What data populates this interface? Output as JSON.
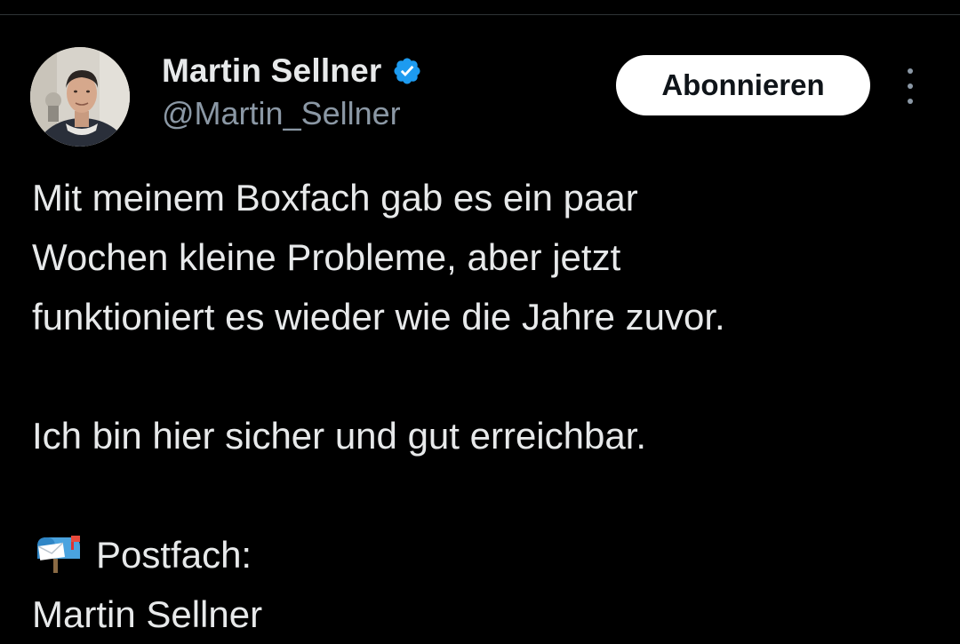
{
  "user": {
    "display_name": "Martin Sellner",
    "handle": "@Martin_Sellner",
    "verified": true,
    "verified_color": "#1d9bf0"
  },
  "actions": {
    "follow_label": "Abonnieren"
  },
  "tweet": {
    "paragraph_1": [
      "Mit meinem Boxfach gab es ein paar",
      "Wochen kleine Probleme, aber jetzt",
      "funktioniert es wieder wie die Jahre zuvor."
    ],
    "paragraph_2": [
      "Ich bin hier sicher und gut erreichbar."
    ],
    "paragraph_3": [
      "Postfach:",
      "Martin Sellner"
    ],
    "paragraph_3_icon": "mailbox-with-mail-icon"
  },
  "colors": {
    "background": "#000000",
    "text": "#e7e9ea",
    "secondary_text": "#8b98a5",
    "button_bg": "#ffffff",
    "button_text": "#0f1419"
  }
}
